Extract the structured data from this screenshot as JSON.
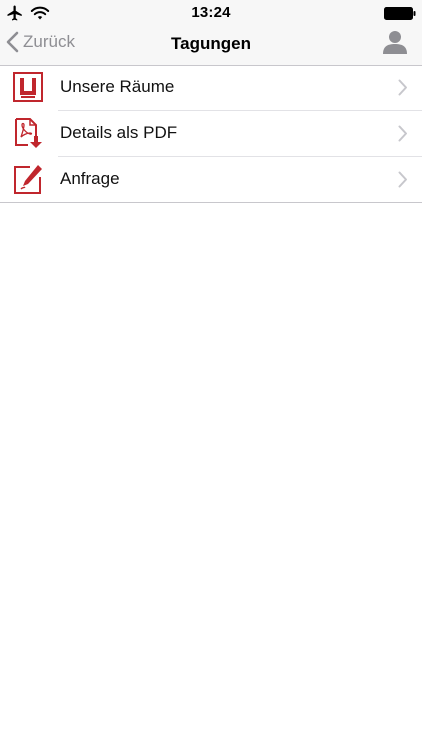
{
  "status_bar": {
    "time": "13:24",
    "icons": [
      "airplane-icon",
      "wifi-icon",
      "battery-icon"
    ]
  },
  "nav": {
    "back_label": "Zurück",
    "title": "Tagungen",
    "right_icon": "person-icon"
  },
  "menu": {
    "items": [
      {
        "label": "Unsere Räume",
        "icon": "rooms-icon"
      },
      {
        "label": "Details als PDF",
        "icon": "pdf-download-icon"
      },
      {
        "label": "Anfrage",
        "icon": "edit-request-icon"
      }
    ]
  },
  "colors": {
    "accent": "#c0262d",
    "back_text": "#8e8e93",
    "chevron": "#c7c7cc",
    "navbar_bg": "#f7f7f7"
  }
}
